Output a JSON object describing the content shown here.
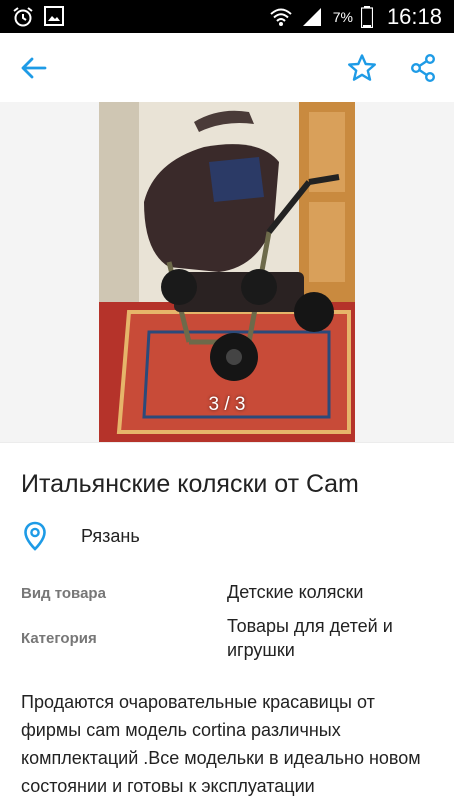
{
  "status_bar": {
    "battery_percent": "7%",
    "time": "16:18",
    "icons": [
      "alarm-icon",
      "gallery-icon",
      "wifi-icon",
      "signal-icon",
      "battery-icon"
    ]
  },
  "app_bar": {
    "back_icon": "arrow-left-icon",
    "favorite_icon": "star-outline-icon",
    "share_icon": "share-icon",
    "accent_color": "#1e9be6"
  },
  "gallery": {
    "counter": "3 / 3",
    "image_description_name": "stroller-photo"
  },
  "listing": {
    "title": "Итальянские коляски от Cam",
    "location": "Рязань",
    "attributes": [
      {
        "label": "Вид товара",
        "value": "Детские коляски"
      },
      {
        "label": "Категория",
        "value": "Товары для детей и игрушки"
      }
    ],
    "description": "Продаются очаровательные красавицы от фирмы cam модель cortina различных комплектаций .Все модельки в идеально новом состоянии и готовы к эксплуатации"
  }
}
